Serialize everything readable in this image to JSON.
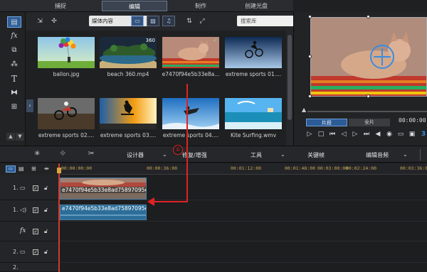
{
  "tabs": [
    {
      "label": "捕捉"
    },
    {
      "label": "编辑"
    },
    {
      "label": "制作"
    },
    {
      "label": "创建光盘"
    }
  ],
  "library": {
    "dropdown_value": "媒体内容",
    "search_placeholder": "搜索库",
    "items": [
      {
        "caption": "ballon.jpg",
        "badge": ""
      },
      {
        "caption": "beach 360.mp4",
        "badge": "360"
      },
      {
        "caption": "e7470f94e5b33e8a...",
        "badge": "✓"
      },
      {
        "caption": "extreme sports 01....",
        "badge": ""
      },
      {
        "caption": "extreme sports 02....",
        "badge": ""
      },
      {
        "caption": "extreme sports 03....",
        "badge": ""
      },
      {
        "caption": "extreme sports 04....",
        "badge": ""
      },
      {
        "caption": "Kite Surfing.wmv",
        "badge": ""
      }
    ]
  },
  "preview": {
    "segment_clip": "片段",
    "segment_movie": "全片",
    "timecode": "00:00:00"
  },
  "edit_toolbar": {
    "designer": "设计器",
    "fix_enhance": "修复/增强",
    "tools": "工具",
    "keyframe": "关键帧",
    "edit_audio": "编辑音频"
  },
  "ruler": {
    "ticks": [
      "00:00:00:00",
      "00:00:36:00",
      "00:01:12:00",
      "00:01:48:00",
      "00:03:00:00",
      "00:02:24:00",
      "00:03:36:00"
    ]
  },
  "tracks": {
    "video1_num": "1.",
    "audio1_num": "1.",
    "fx_label": "fx",
    "video2_num": "2.",
    "audio2_num": "2."
  },
  "clip": {
    "video_name": "e7470f94e5b33e8ad75897095e",
    "audio_name": "e7470f94e5b33e8ad75897095e"
  },
  "callout": {
    "number": "①"
  },
  "colors": {
    "accent": "#2f5f9a",
    "callout": "#e02222",
    "ruler_text": "#c8a85a"
  }
}
